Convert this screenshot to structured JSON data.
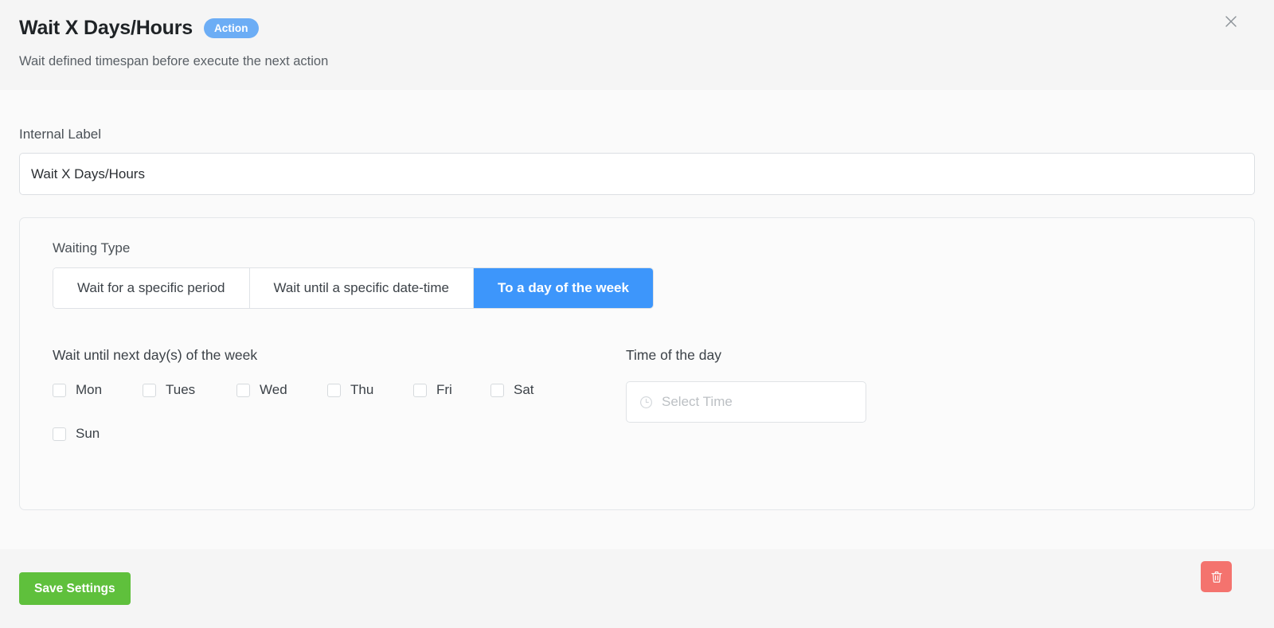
{
  "header": {
    "title": "Wait X Days/Hours",
    "badge": "Action",
    "subtitle": "Wait defined timespan before execute the next action",
    "close_icon": "close-icon"
  },
  "body": {
    "internal_label": {
      "label": "Internal Label",
      "value": "Wait X Days/Hours",
      "placeholder": "Internal Label"
    },
    "card": {
      "waiting_type_label": "Waiting Type",
      "tabs": [
        {
          "label": "Wait for a specific period",
          "active": false
        },
        {
          "label": "Wait until a specific date-time",
          "active": false
        },
        {
          "label": "To a day of the week",
          "active": true
        }
      ],
      "days": {
        "label": "Wait until next day(s) of the week",
        "options": [
          {
            "label": "Mon",
            "checked": false
          },
          {
            "label": "Tues",
            "checked": false
          },
          {
            "label": "Wed",
            "checked": false
          },
          {
            "label": "Thu",
            "checked": false
          },
          {
            "label": "Fri",
            "checked": false
          },
          {
            "label": "Sat",
            "checked": false
          },
          {
            "label": "Sun",
            "checked": false
          }
        ]
      },
      "time": {
        "label": "Time of the day",
        "placeholder": "Select Time",
        "value": "",
        "icon": "clock-icon"
      }
    }
  },
  "footer": {
    "save_label": "Save Settings",
    "delete_icon": "trash-icon"
  },
  "colors": {
    "accent_blue": "#3d96fb",
    "badge_blue": "#6cadf5",
    "save_green": "#5fc03c",
    "delete_red": "#f4736e",
    "header_bg": "#f5f5f5",
    "body_bg": "#fafafa"
  }
}
